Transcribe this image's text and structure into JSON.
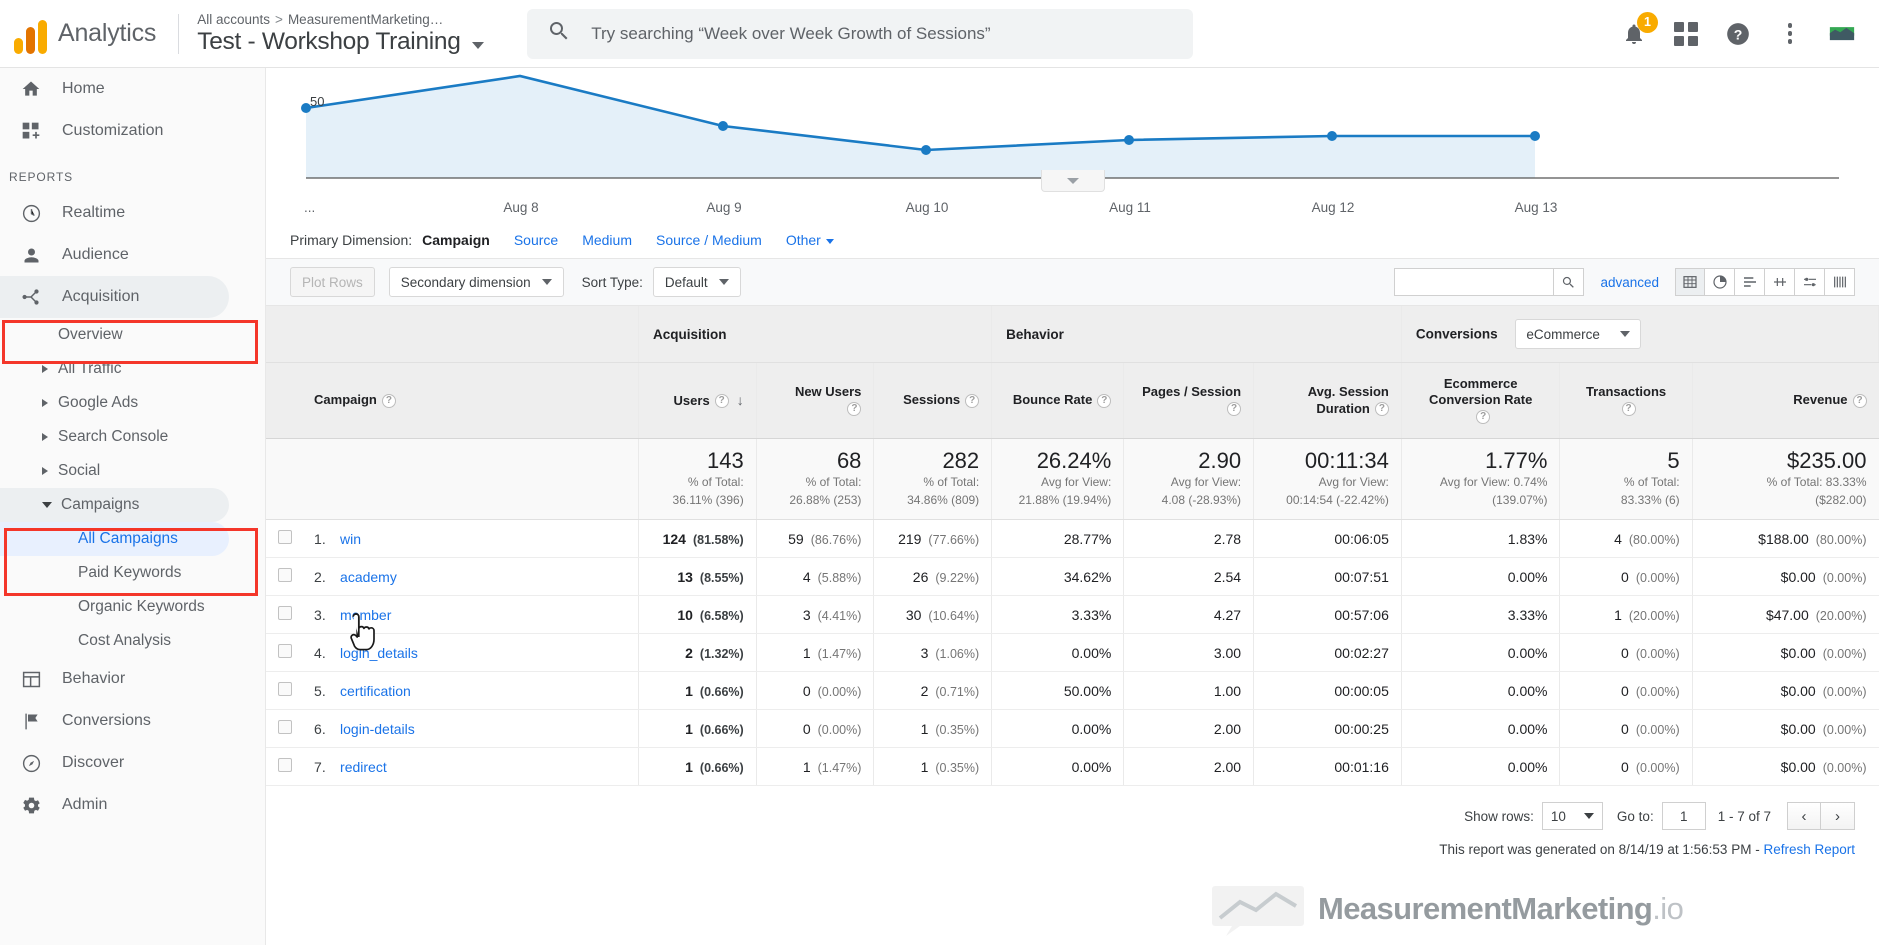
{
  "header": {
    "brand": "Analytics",
    "breadcrumb_root": "All accounts",
    "breadcrumb_sep": ">",
    "breadcrumb_account": "MeasurementMarketing…",
    "property": "Test - Workshop Training",
    "search_placeholder": "Try searching “Week over Week Growth of Sessions”",
    "notifications_count": "1",
    "icons": [
      "search-icon",
      "bell-icon",
      "apps-grid-icon",
      "help-icon",
      "more-vert-icon",
      "analytics-chart-icon"
    ]
  },
  "sidebar": {
    "items": [
      {
        "label": "Home",
        "icon": "home-icon"
      },
      {
        "label": "Customization",
        "icon": "customization-icon"
      }
    ],
    "section_label": "REPORTS",
    "reports": [
      {
        "label": "Realtime",
        "icon": "clock-icon"
      },
      {
        "label": "Audience",
        "icon": "person-icon"
      },
      {
        "label": "Acquisition",
        "icon": "acquisition-icon"
      }
    ],
    "acquisition_children": [
      {
        "label": "Overview",
        "expandable": false
      },
      {
        "label": "All Traffic",
        "expandable": true
      },
      {
        "label": "Google Ads",
        "expandable": true
      },
      {
        "label": "Search Console",
        "expandable": true
      },
      {
        "label": "Social",
        "expandable": true
      },
      {
        "label": "Campaigns",
        "expandable": true,
        "expanded": true
      }
    ],
    "campaign_children": [
      {
        "label": "All Campaigns",
        "selected": true
      },
      {
        "label": "Paid Keywords",
        "selected": false
      },
      {
        "label": "Organic Keywords",
        "selected": false
      },
      {
        "label": "Cost Analysis",
        "selected": false
      }
    ],
    "bottom": [
      {
        "label": "Behavior",
        "icon": "behavior-icon"
      },
      {
        "label": "Conversions",
        "icon": "flag-icon"
      },
      {
        "label": "Discover",
        "icon": "discover-icon"
      },
      {
        "label": "Admin",
        "icon": "gear-icon"
      }
    ]
  },
  "chart_data": {
    "type": "line",
    "title": "",
    "xlabel": "",
    "ylabel": "",
    "y_axis_label": "50",
    "axis_prefix": "...",
    "categories": [
      "Aug 8",
      "Aug 9",
      "Aug 10",
      "Aug 11",
      "Aug 12",
      "Aug 13"
    ],
    "values": [
      67,
      41,
      25,
      28,
      30,
      30
    ],
    "ylim": [
      0,
      75
    ],
    "grid": false,
    "legend": "none",
    "line_color": "#1a7bc4",
    "fill_color": "#e4f0f9"
  },
  "dimension_bar": {
    "label": "Primary Dimension:",
    "active": "Campaign",
    "links": [
      "Source",
      "Medium",
      "Source / Medium"
    ],
    "other": "Other"
  },
  "controls": {
    "plot_rows": "Plot Rows",
    "secondary_dimension": "Secondary dimension",
    "sort_type_label": "Sort Type:",
    "sort_type_value": "Default",
    "search_value": "",
    "advanced": "advanced",
    "view_buttons": [
      "table-view-icon",
      "pie-view-icon",
      "bar-view-icon",
      "comparison-view-icon",
      "pivot-view-icon",
      "performance-view-icon"
    ]
  },
  "table": {
    "groups": [
      {
        "label": "Acquisition",
        "span": 3
      },
      {
        "label": "Behavior",
        "span": 3
      },
      {
        "label": "Conversions",
        "span": 3,
        "selector": "eCommerce"
      }
    ],
    "dimension_header": "Campaign",
    "columns": [
      {
        "label": "Users",
        "sorted": true
      },
      {
        "label": "New Users"
      },
      {
        "label": "Sessions"
      },
      {
        "label": "Bounce Rate"
      },
      {
        "label": "Pages / Session"
      },
      {
        "label": "Avg. Session Duration"
      },
      {
        "label": "Ecommerce Conversion Rate"
      },
      {
        "label": "Transactions"
      },
      {
        "label": "Revenue"
      }
    ],
    "summary": [
      {
        "value": "143",
        "note1": "% of Total:",
        "note2": "36.11% (396)"
      },
      {
        "value": "68",
        "note1": "% of Total:",
        "note2": "26.88% (253)"
      },
      {
        "value": "282",
        "note1": "% of Total:",
        "note2": "34.86% (809)"
      },
      {
        "value": "26.24%",
        "note1": "Avg for View:",
        "note2": "21.88% (19.94%)"
      },
      {
        "value": "2.90",
        "note1": "Avg for View:",
        "note2": "4.08 (-28.93%)"
      },
      {
        "value": "00:11:34",
        "note1": "Avg for View:",
        "note2": "00:14:54 (-22.42%)"
      },
      {
        "value": "1.77%",
        "note1": "Avg for View: 0.74%",
        "note2": "(139.07%)"
      },
      {
        "value": "5",
        "note1": "% of Total:",
        "note2": "83.33% (6)"
      },
      {
        "value": "$235.00",
        "note1": "% of Total: 83.33%",
        "note2": "($282.00)"
      }
    ],
    "rows": [
      {
        "index": "1.",
        "name": "win",
        "users": "124",
        "users_pct": "(81.58%)",
        "new_users": "59",
        "new_users_pct": "(86.76%)",
        "sessions": "219",
        "sessions_pct": "(77.66%)",
        "bounce": "28.77%",
        "pages": "2.78",
        "duration": "00:06:05",
        "ecom": "1.83%",
        "trans": "4",
        "trans_pct": "(80.00%)",
        "rev": "$188.00",
        "rev_pct": "(80.00%)"
      },
      {
        "index": "2.",
        "name": "academy",
        "users": "13",
        "users_pct": "(8.55%)",
        "new_users": "4",
        "new_users_pct": "(5.88%)",
        "sessions": "26",
        "sessions_pct": "(9.22%)",
        "bounce": "34.62%",
        "pages": "2.54",
        "duration": "00:07:51",
        "ecom": "0.00%",
        "trans": "0",
        "trans_pct": "(0.00%)",
        "rev": "$0.00",
        "rev_pct": "(0.00%)"
      },
      {
        "index": "3.",
        "name": "member",
        "users": "10",
        "users_pct": "(6.58%)",
        "new_users": "3",
        "new_users_pct": "(4.41%)",
        "sessions": "30",
        "sessions_pct": "(10.64%)",
        "bounce": "3.33%",
        "pages": "4.27",
        "duration": "00:57:06",
        "ecom": "3.33%",
        "trans": "1",
        "trans_pct": "(20.00%)",
        "rev": "$47.00",
        "rev_pct": "(20.00%)"
      },
      {
        "index": "4.",
        "name": "login_details",
        "users": "2",
        "users_pct": "(1.32%)",
        "new_users": "1",
        "new_users_pct": "(1.47%)",
        "sessions": "3",
        "sessions_pct": "(1.06%)",
        "bounce": "0.00%",
        "pages": "3.00",
        "duration": "00:02:27",
        "ecom": "0.00%",
        "trans": "0",
        "trans_pct": "(0.00%)",
        "rev": "$0.00",
        "rev_pct": "(0.00%)"
      },
      {
        "index": "5.",
        "name": "certification",
        "users": "1",
        "users_pct": "(0.66%)",
        "new_users": "0",
        "new_users_pct": "(0.00%)",
        "sessions": "2",
        "sessions_pct": "(0.71%)",
        "bounce": "50.00%",
        "pages": "1.00",
        "duration": "00:00:05",
        "ecom": "0.00%",
        "trans": "0",
        "trans_pct": "(0.00%)",
        "rev": "$0.00",
        "rev_pct": "(0.00%)"
      },
      {
        "index": "6.",
        "name": "login-details",
        "users": "1",
        "users_pct": "(0.66%)",
        "new_users": "0",
        "new_users_pct": "(0.00%)",
        "sessions": "1",
        "sessions_pct": "(0.35%)",
        "bounce": "0.00%",
        "pages": "2.00",
        "duration": "00:00:25",
        "ecom": "0.00%",
        "trans": "0",
        "trans_pct": "(0.00%)",
        "rev": "$0.00",
        "rev_pct": "(0.00%)"
      },
      {
        "index": "7.",
        "name": "redirect",
        "users": "1",
        "users_pct": "(0.66%)",
        "new_users": "1",
        "new_users_pct": "(1.47%)",
        "sessions": "1",
        "sessions_pct": "(0.35%)",
        "bounce": "0.00%",
        "pages": "2.00",
        "duration": "00:01:16",
        "ecom": "0.00%",
        "trans": "0",
        "trans_pct": "(0.00%)",
        "rev": "$0.00",
        "rev_pct": "(0.00%)"
      }
    ]
  },
  "footer": {
    "show_rows_label": "Show rows:",
    "show_rows_value": "10",
    "goto_label": "Go to:",
    "goto_value": "1",
    "range": "1 - 7 of 7",
    "prev": "‹",
    "next": "›",
    "generated": "This report was generated on 8/14/19 at 1:56:53 PM - ",
    "refresh": "Refresh Report"
  },
  "watermark": {
    "text": "MeasurementMarketing",
    "suffix": ".io"
  },
  "colors": {
    "accent": "#1a73e8",
    "highlight_box": "#f4362a",
    "chart_line": "#1a7bc4"
  }
}
